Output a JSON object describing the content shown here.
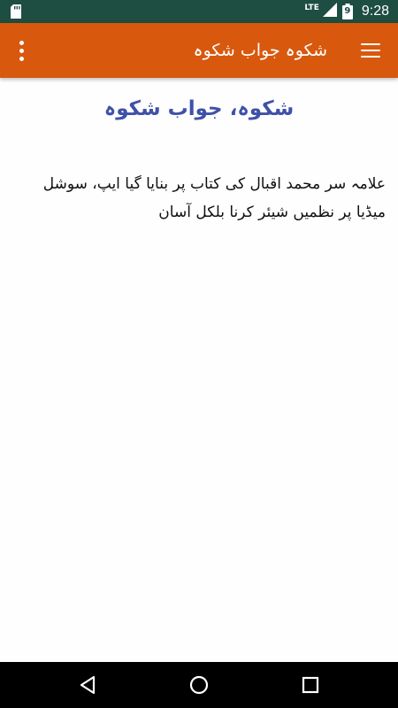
{
  "status_bar": {
    "network": "LTE",
    "battery_level": "9",
    "time": "9:28"
  },
  "app_bar": {
    "title": "شکوہ جواب شکوہ"
  },
  "main": {
    "heading": "شکوہ، جواب شکوہ",
    "description": "علامہ سر محمد اقبال کی کتاب پر بنایا گیا ایپ، سوشل میڈیا پر نظمیں شیئر کرنا بلکل آسان"
  },
  "icons": {
    "status": [
      "sd-card-icon",
      "signal-icon",
      "battery-icon"
    ],
    "app_bar": [
      "overflow-menu-icon",
      "hamburger-menu-icon"
    ],
    "nav": [
      "back-icon",
      "home-icon",
      "recent-apps-icon"
    ]
  },
  "colors": {
    "status_bar": "#1e4d42",
    "app_bar": "#d8580e",
    "heading": "#3f51a8",
    "background": "#fefefe",
    "nav_bar": "#000000"
  }
}
